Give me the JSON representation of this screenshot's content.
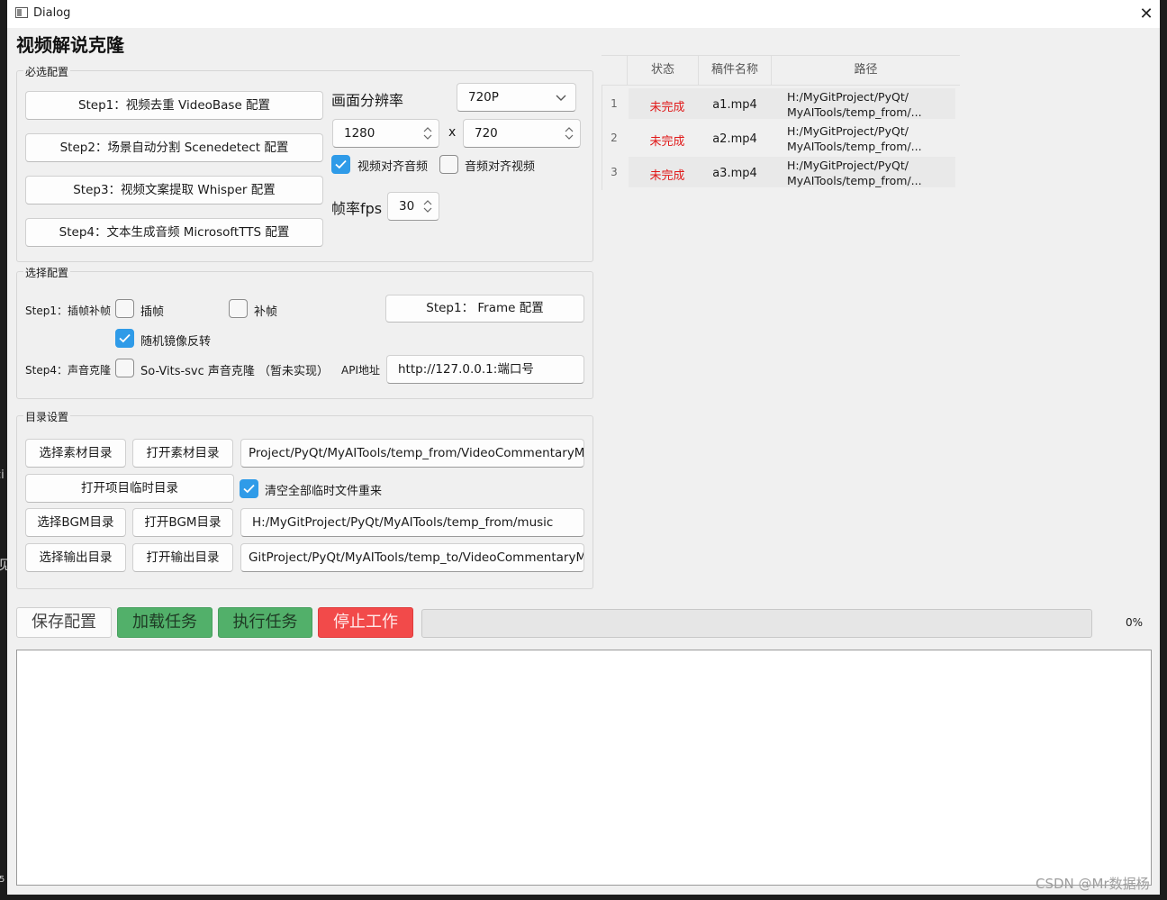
{
  "edge_fragments": [
    "见",
    "ci",
    "5"
  ],
  "window": {
    "title": "Dialog",
    "close_glyph": "✕"
  },
  "page_title": "视频解说克隆",
  "required": {
    "title": "必选配置",
    "steps": [
      "Step1：视频去重 VideoBase 配置",
      "Step2：场景自动分割 Scenedetect 配置",
      "Step3：视频文案提取 Whisper 配置",
      "Step4：文本生成音频 MicrosoftTTS 配置"
    ],
    "resolution_label": "画面分辨率",
    "resolution_preset": "720P",
    "width": "1280",
    "x_sep": "x",
    "height": "720",
    "align_video_to_audio": {
      "label": "视频对齐音频",
      "checked": true
    },
    "align_audio_to_video": {
      "label": "音频对齐视频",
      "checked": false
    },
    "fps_label": "帧率fps",
    "fps": "30"
  },
  "optional": {
    "title": "选择配置",
    "step1_label": "Step1：插帧补帧",
    "interp": {
      "label": "插帧",
      "checked": false
    },
    "fill": {
      "label": "补帧",
      "checked": false
    },
    "frame_btn": "Step1： Frame 配置",
    "mirror": {
      "label": "随机镜像反转",
      "checked": true
    },
    "step4_label": "Step4：声音克隆",
    "voice": {
      "label": "So-Vits-svc 声音克隆 （暂未实现）",
      "checked": false
    },
    "api_label": "API地址",
    "api_value": "http://127.0.0.1:端口号"
  },
  "dirs": {
    "title": "目录设置",
    "select_material": "选择素材目录",
    "open_material": "打开素材目录",
    "material_path": "Project/PyQt/MyAITools/temp_from/VideoCommentaryMix",
    "open_temp": "打开项目临时目录",
    "clear_temp": {
      "label": "清空全部临时文件重来",
      "checked": true
    },
    "select_bgm": "选择BGM目录",
    "open_bgm": "打开BGM目录",
    "bgm_path": "H:/MyGitProject/PyQt/MyAITools/temp_from/music",
    "select_output": "选择输出目录",
    "open_output": "打开输出目录",
    "output_path": "GitProject/PyQt/MyAITools/temp_to/VideoCommentaryMix"
  },
  "table": {
    "headers": [
      "状态",
      "稿件名称",
      "路径"
    ],
    "rows": [
      {
        "num": "1",
        "status": "未完成",
        "name": "a1.mp4",
        "path1": "H:/MyGitProject/PyQt/",
        "path2": "MyAITools/temp_from/..."
      },
      {
        "num": "2",
        "status": "未完成",
        "name": "a2.mp4",
        "path1": "H:/MyGitProject/PyQt/",
        "path2": "MyAITools/temp_from/..."
      },
      {
        "num": "3",
        "status": "未完成",
        "name": "a3.mp4",
        "path1": "H:/MyGitProject/PyQt/",
        "path2": "MyAITools/temp_from/..."
      }
    ]
  },
  "actions": {
    "save": "保存配置",
    "load": "加载任务",
    "run": "执行任务",
    "stop": "停止工作",
    "progress": 0,
    "progress_text": "0%"
  },
  "colors": {
    "status_incomplete": "#e01818",
    "checkbox_checked": "#2f9be8",
    "load_btn": "#52b06a",
    "run_btn": "#52b06a",
    "stop_btn": "#f24a4a"
  },
  "icons": [
    "app-icon",
    "close-icon",
    "chevron-down-icon",
    "spin-arrows-icon",
    "checkmark-icon"
  ],
  "watermark": "CSDN @Mr数据杨"
}
